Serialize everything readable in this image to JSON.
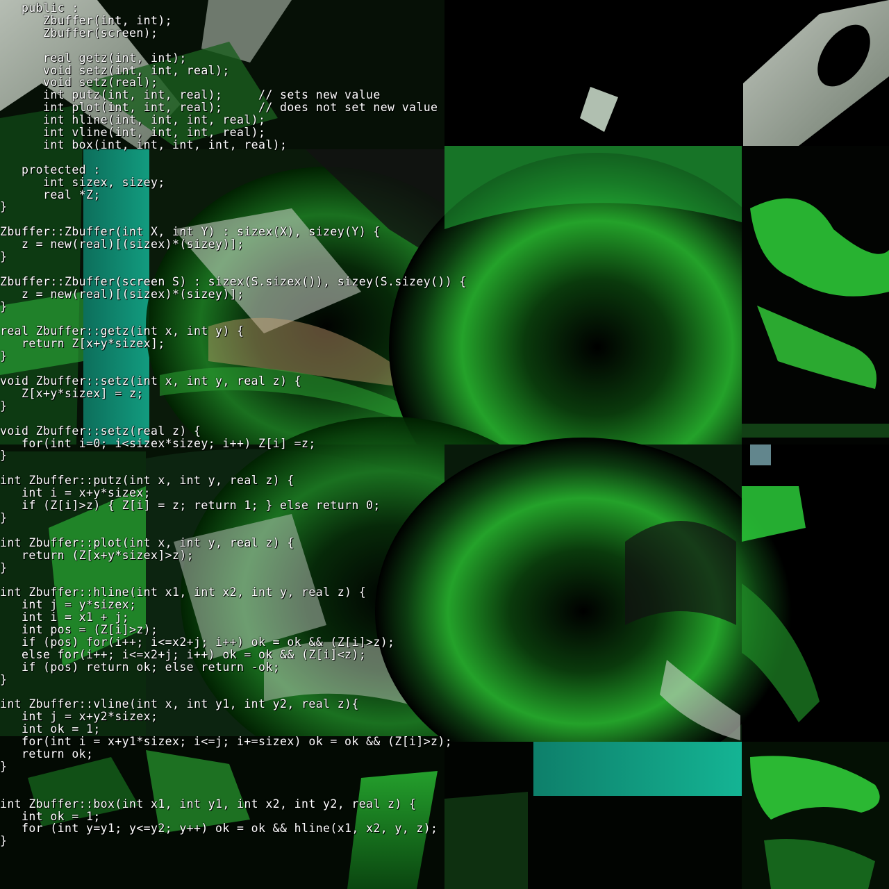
{
  "palette": {
    "background": "#000000",
    "text": "#ffffff",
    "green_bright": "#2bdc2b",
    "green_mid": "#1f9a2a",
    "teal": "#10a086",
    "grey": "#b8c2b8"
  },
  "code": {
    "lines": [
      {
        "text": "   public :"
      },
      {
        "text": "      Zbuffer(int, int);"
      },
      {
        "text": "      Zbuffer(screen);"
      },
      {
        "text": ""
      },
      {
        "text": "      real getz(int, int);"
      },
      {
        "text": "      void setz(int, int, real);"
      },
      {
        "text": "      void setz(real);"
      },
      {
        "text": "      int putz(int, int, real);     // sets new value"
      },
      {
        "text": "      int plot(int, int, real);     // does not set new value"
      },
      {
        "text": "      int hline(int, int, int, real);"
      },
      {
        "text": "      int vline(int, int, int, real);"
      },
      {
        "text": "      int box(int, int, int, int, real);"
      },
      {
        "text": ""
      },
      {
        "text": "   protected :"
      },
      {
        "text": "      int sizex, sizey;"
      },
      {
        "text": "      real *Z;"
      },
      {
        "text": "}"
      },
      {
        "text": ""
      },
      {
        "text": "Zbuffer::Zbuffer(int X, int Y) : sizex(X), sizey(Y) {"
      },
      {
        "text": "   z = new(real)[(sizex)*(sizey)];"
      },
      {
        "text": "}"
      },
      {
        "text": ""
      },
      {
        "text": "Zbuffer::Zbuffer(screen S) : sizex(S.sizex()), sizey(S.sizey()) {"
      },
      {
        "text": "   z = new(real)[(sizex)*(sizey)];"
      },
      {
        "text": "}"
      },
      {
        "text": ""
      },
      {
        "text": "real Zbuffer::getz(int x, int y) {"
      },
      {
        "text": "   return Z[x+y*sizex];"
      },
      {
        "text": "}"
      },
      {
        "text": ""
      },
      {
        "text": "void Zbuffer::setz(int x, int y, real z) {"
      },
      {
        "text": "   Z[x+y*sizex] = z;"
      },
      {
        "text": "}"
      },
      {
        "text": ""
      },
      {
        "text": "void Zbuffer::setz(real z) {"
      },
      {
        "text": "   for(int i=0; i<sizex*sizey; i++) Z[i] =z;"
      },
      {
        "text": "}"
      },
      {
        "text": ""
      },
      {
        "text": "int Zbuffer::putz(int x, int y, real z) {"
      },
      {
        "text": "   int i = x+y*sizex;"
      },
      {
        "text": "   if (Z[i]>z) { Z[i] = z; return 1; } else return 0;"
      },
      {
        "text": "}"
      },
      {
        "text": ""
      },
      {
        "text": "int Zbuffer::plot(int x, int y, real z) {"
      },
      {
        "text": "   return (Z[x+y*sizex]>z);"
      },
      {
        "text": "}"
      },
      {
        "text": ""
      },
      {
        "text": "int Zbuffer::hline(int x1, int x2, int y, real z) {"
      },
      {
        "text": "   int j = y*sizex;"
      },
      {
        "text": "   int i = x1 + j;"
      },
      {
        "text": "   int pos = (Z[i]>z);"
      },
      {
        "text": "   if (pos) for(i++; i<=x2+j; i++) ok = ok && (Z[i]>z);"
      },
      {
        "text": "   else for(i++; i<=x2+j; i++) ok = ok && (Z[i]<z);"
      },
      {
        "text": "   if (pos) return ok; else return -ok;"
      },
      {
        "text": "}"
      },
      {
        "text": ""
      },
      {
        "text": "int Zbuffer::vline(int x, int y1, int y2, real z){"
      },
      {
        "text": "   int j = x+y2*sizex;"
      },
      {
        "text": "   int ok = 1;"
      },
      {
        "text": "   for(int i = x+y1*sizex; i<=j; i+=sizex) ok = ok && (Z[i]>z);"
      },
      {
        "text": "   return ok;"
      },
      {
        "text": "}"
      },
      {
        "text": ""
      },
      {
        "text": ""
      },
      {
        "text": "int Zbuffer::box(int x1, int y1, int x2, int y2, real z) {"
      },
      {
        "text": "   int ok = 1;"
      },
      {
        "text": "   for (int y=y1; y<=y2; y++) ok = ok && hline(x1, x2, y, z);"
      },
      {
        "text": "}"
      }
    ]
  }
}
